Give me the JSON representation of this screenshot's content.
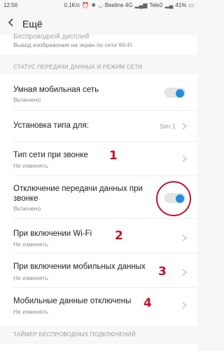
{
  "status_bar": {
    "time": "12:56",
    "speed": "0,1K/c",
    "carrier1": "Beeline 4G",
    "carrier2": "Tele2",
    "battery": "41%"
  },
  "header": {
    "title": "Ещё"
  },
  "cut_item": {
    "title": "Беспроводной дисплей",
    "subtitle": "Вывод изображения на экран по сети Wi-Fi"
  },
  "section1": {
    "label": "СТАТУС ПЕРЕДАЧИ ДАННЫХ И РЕЖИМ СЕТИ"
  },
  "rows": [
    {
      "title": "Умная мобильная сеть",
      "subtitle": "Включено",
      "control": "toggle",
      "on": true
    },
    {
      "title": "Установка типа для:",
      "value": "Sim 1",
      "control": "chevron"
    },
    {
      "title": "Тип сети при звонке",
      "subtitle": "Не изменять",
      "control": "chevron",
      "marker": "1"
    },
    {
      "title_line1": "Отключение передачи данных при",
      "title_line2": "звонке",
      "subtitle": "Включено",
      "control": "toggle",
      "on": true
    },
    {
      "title": "При включении Wi-Fi",
      "subtitle": "Не изменять",
      "control": "chevron",
      "marker": "2"
    },
    {
      "title": "При включении мобильных данных",
      "subtitle": "Не изменять",
      "control": "chevron",
      "marker": "3"
    },
    {
      "title": "Мобильные данные отключены",
      "subtitle": "Не изменять",
      "control": "chevron",
      "marker": "4"
    }
  ],
  "section2": {
    "label": "ТАЙМЕР БЕСПРОВОДНЫХ ПОДКЛЮЧЕНИЙ"
  },
  "colors": {
    "accent": "#1e8fde",
    "annotation": "#c8102e"
  },
  "icons": [
    "back-arrow-icon",
    "chevron-right-icon",
    "signal-icon",
    "battery-icon",
    "alarm-icon",
    "bluetooth-icon"
  ]
}
